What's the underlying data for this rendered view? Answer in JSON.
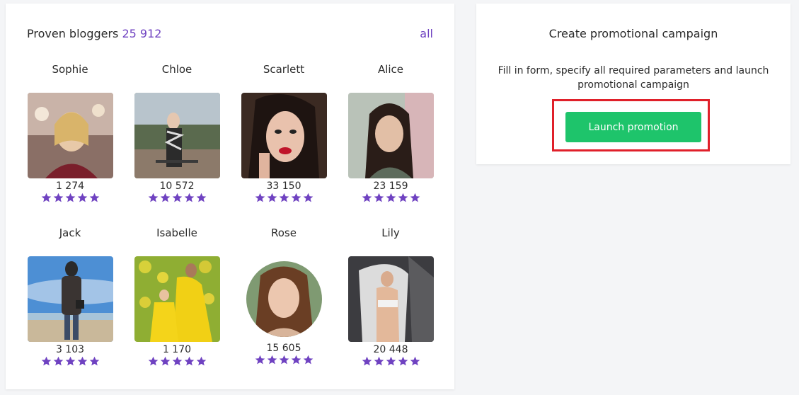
{
  "bloggers_panel": {
    "title": "Proven bloggers",
    "count": "25 912",
    "all_link": "all",
    "star_color": "#6f42c1",
    "bloggers": [
      {
        "name": "Sophie",
        "followers": "1 274",
        "rating": 5
      },
      {
        "name": "Chloe",
        "followers": "10 572",
        "rating": 5
      },
      {
        "name": "Scarlett",
        "followers": "33 150",
        "rating": 5
      },
      {
        "name": "Alice",
        "followers": "23 159",
        "rating": 5
      },
      {
        "name": "Jack",
        "followers": "3 103",
        "rating": 5
      },
      {
        "name": "Isabelle",
        "followers": "1 170",
        "rating": 5
      },
      {
        "name": "Rose",
        "followers": "15 605",
        "rating": 5
      },
      {
        "name": "Lily",
        "followers": "20 448",
        "rating": 5
      }
    ]
  },
  "campaign_panel": {
    "title": "Create promotional campaign",
    "description": "Fill in form, specify all required parameters and launch promotional campaign",
    "button_label": "Launch promotion",
    "button_color": "#1ec46b",
    "highlight_color": "#e0202a"
  }
}
